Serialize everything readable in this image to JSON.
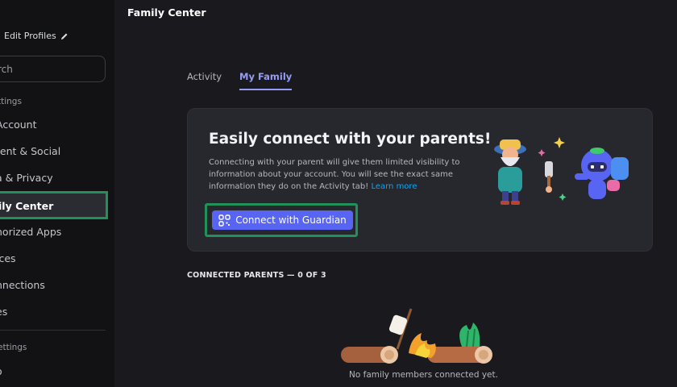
{
  "sidebar": {
    "edit_profiles": "Edit Profiles",
    "search_placeholder": "Search",
    "search_visible": "rch",
    "header_user_settings": "ttings",
    "header_app_settings": "ettings",
    "items": [
      {
        "label": "Account",
        "visible": "Account"
      },
      {
        "label": "Content & Social",
        "visible": "tent & Social"
      },
      {
        "label": "Data & Privacy",
        "visible": "a & Privacy"
      },
      {
        "label": "Family Center",
        "visible": "ily Center"
      },
      {
        "label": "Authorized Apps",
        "visible": "horized Apps"
      },
      {
        "label": "Devices",
        "visible": "ices"
      },
      {
        "label": "Connections",
        "visible": "nnections"
      },
      {
        "label": "Clips",
        "visible": "es"
      },
      {
        "label": "Nitro",
        "visible": "o"
      }
    ],
    "active_item": "Family Center"
  },
  "header": {
    "title": "Family Center"
  },
  "tabs": [
    {
      "label": "Activity",
      "selected": false
    },
    {
      "label": "My Family",
      "selected": true
    }
  ],
  "card": {
    "title": "Easily connect with your parents!",
    "description": "Connecting with your parent will give them limited visibility to information about your account. You will see the exact same information they do on the Activity tab!",
    "link": "Learn more",
    "button_label": "Connect with Guardian"
  },
  "connected": {
    "label": "CONNECTED PARENTS — 0 OF 3",
    "empty_text": "No family members connected yet."
  },
  "colors": {
    "accent": "#5865f2",
    "tab_accent": "#949cf7",
    "highlight_frame": "#22905a",
    "link": "#00a8fc"
  }
}
